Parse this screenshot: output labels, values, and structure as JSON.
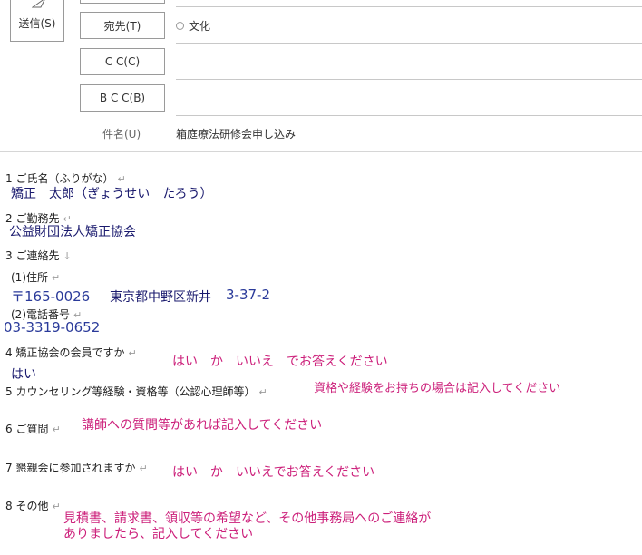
{
  "toolbar": {
    "send_label": "送信(S)"
  },
  "header": {
    "to_label": "宛先(T)",
    "to_value": "文化",
    "cc_label": "C C(C)",
    "bcc_label": "B C C(B)",
    "subject_label": "件名(U)",
    "subject_value": "箱庭療法研修会申し込み"
  },
  "body": {
    "q1": "1 ご氏名（ふりがな）",
    "a1": "矯正　太郎（ぎょうせい　たろう）",
    "q2": "2 ご勤務先",
    "a2": "公益財団法人矯正協会",
    "q3": "3 ご連絡先",
    "q3_1": "(1)住所",
    "a3_1_zip": "〒165-0026",
    "a3_1_addr": "東京都中野区新井",
    "a3_1_num": "3-37-2",
    "q3_2": "(2)電話番号",
    "a3_2": "03-3319-0652",
    "q4": "4 矯正協会の会員ですか",
    "h4": "はい　か　いいえ　でお答えください",
    "a4": "はい",
    "q5": "5 カウンセリング等経験・資格等（公認心理師等）",
    "h5": "資格や経験をお持ちの場合は記入してください",
    "q6": "6 ご質問",
    "h6": "講師への質問等があれば記入してください",
    "q7": "7 懇親会に参加されますか",
    "h7": "はい　か　いいえでお答えください",
    "q8": "8 その他",
    "h8_line1": "見積書、請求書、領収等の希望など、その他事務局へのご連絡が",
    "h8_line2": "ありましたら、記入してください",
    "return_mark": "↵",
    "down_mark": "↓"
  }
}
